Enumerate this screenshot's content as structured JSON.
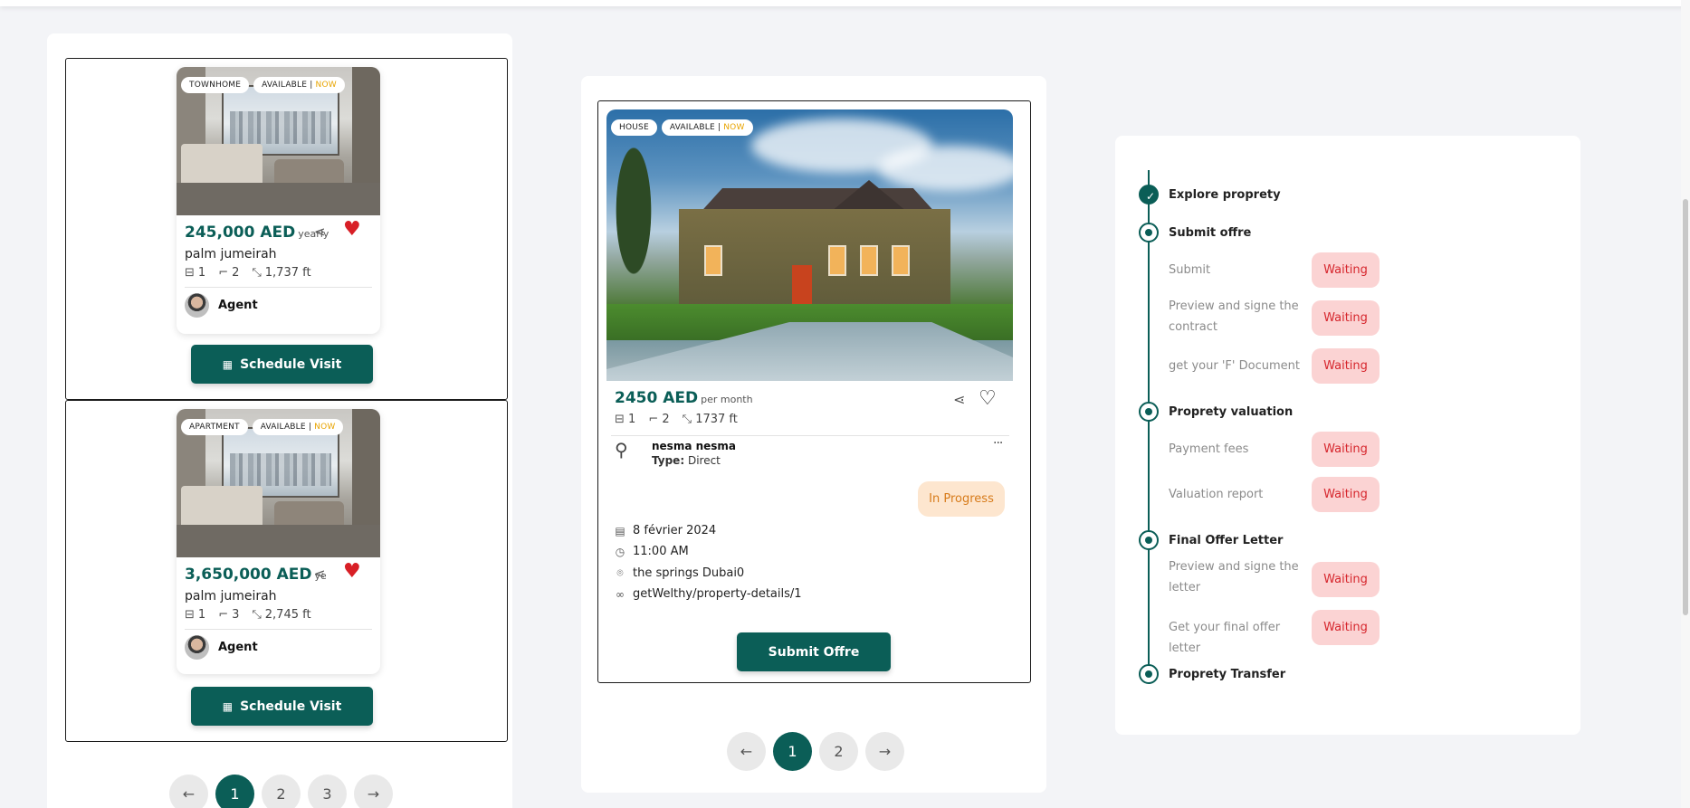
{
  "listings": [
    {
      "type_tag": "TOWNHOME",
      "avail_tag": "AVAILABLE",
      "now_tag": "NOW",
      "price": "245,000 AED",
      "period": "yearly",
      "location": "palm jumeirah",
      "beds": "1",
      "baths": "2",
      "area": "1,737 ft",
      "agent": "Agent",
      "button": "Schedule Visit",
      "favorite": true
    },
    {
      "type_tag": "APARTMENT",
      "avail_tag": "AVAILABLE",
      "now_tag": "NOW",
      "price": "3,650,000 AED",
      "period": "yearly",
      "location": "palm jumeirah",
      "beds": "1",
      "baths": "3",
      "area": "2,745 ft",
      "agent": "Agent",
      "button": "Schedule Visit",
      "favorite": true
    }
  ],
  "left_pagination": {
    "prev": "←",
    "pages": [
      "1",
      "2",
      "3"
    ],
    "active": "1",
    "next": "→"
  },
  "offer_card": {
    "type_tag": "HOUSE",
    "avail_tag": "AVAILABLE",
    "now_tag": "NOW",
    "price": "2450 AED",
    "period": "per month",
    "beds": "1",
    "baths": "2",
    "area": "1737 ft",
    "user_name": "nesma nesma",
    "type_label": "Type:",
    "type_value": "Direct",
    "more": "···",
    "status": "In Progress",
    "date": "8 février 2024",
    "time": "11:00 AM",
    "address": "the springs Dubai0",
    "link": "getWelthy/property-details/1",
    "button": "Submit Offre"
  },
  "mid_pagination": {
    "prev": "←",
    "pages": [
      "1",
      "2"
    ],
    "active": "1",
    "next": "→"
  },
  "steps": [
    {
      "title": "Explore proprety",
      "state": "done",
      "subs": []
    },
    {
      "title": "Submit offre",
      "state": "active",
      "subs": [
        {
          "label": "Submit",
          "status": "Waiting"
        },
        {
          "label": "Preview and signe the contract",
          "status": "Waiting"
        },
        {
          "label": "get your 'F' Document",
          "status": "Waiting"
        }
      ]
    },
    {
      "title": "Proprety valuation",
      "state": "pending",
      "subs": [
        {
          "label": "Payment fees",
          "status": "Waiting"
        },
        {
          "label": "Valuation report",
          "status": "Waiting"
        }
      ]
    },
    {
      "title": "Final Offer Letter",
      "state": "pending",
      "subs": [
        {
          "label": "Preview and signe the letter",
          "status": "Waiting"
        },
        {
          "label": "Get your final offer letter",
          "status": "Waiting"
        }
      ]
    },
    {
      "title": "Proprety Transfer",
      "state": "pending",
      "subs": []
    }
  ],
  "icons": {
    "share": "share-icon",
    "heart": "heart-icon",
    "bed": "bed-icon",
    "bath": "bath-icon",
    "area": "area-icon",
    "calendar": "calendar-icon",
    "clock": "clock-icon",
    "pin": "location-pin-icon",
    "link": "link-icon",
    "user": "user-icon",
    "check": "check-icon"
  },
  "colors": {
    "brand": "#0b5e57",
    "favorite": "#d81f26",
    "now": "#e8a400",
    "waiting_bg": "#fbd3d3",
    "waiting_text": "#d6262d",
    "progress_bg": "#fde6cf",
    "progress_text": "#d77b1a"
  }
}
